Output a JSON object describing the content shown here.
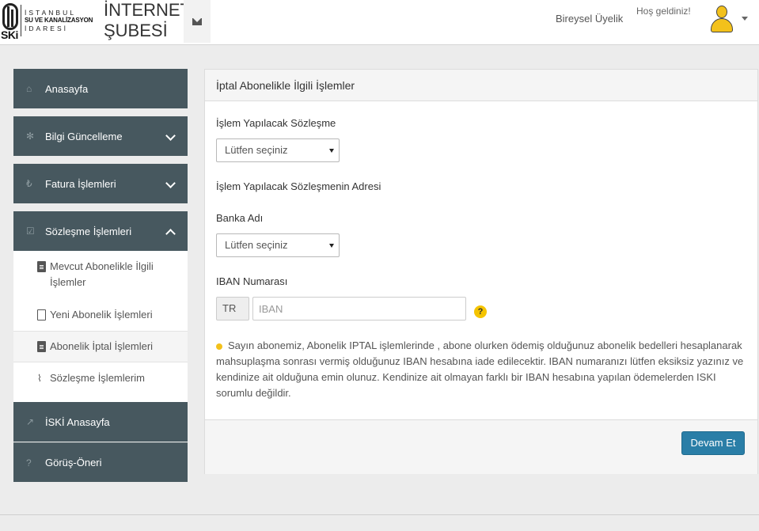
{
  "header": {
    "logo": {
      "mark": "SKi",
      "line1": "İSTANBUL",
      "line2": "SU VE KANALİZASYON",
      "line3": "İDARESİ"
    },
    "brand_line1": "İNTERNET",
    "brand_line2": "ŞUBESİ",
    "mail_icon": "envelope-icon",
    "membership": "Bireysel Üyelik",
    "welcome": "Hoş geldiniz!",
    "avatar_icon": "user-icon",
    "colors": {
      "avatar": "#f3c11b"
    }
  },
  "sidebar": {
    "colors": {
      "nav_bg": "#47585f",
      "nav_text": "#ffffff"
    },
    "items": [
      {
        "label": "Anasayfa",
        "icon": "home-icon"
      },
      {
        "label": "Bilgi Güncelleme",
        "icon": "gear-icon"
      },
      {
        "label": "Fatura İşlemleri",
        "icon": "lira-icon"
      },
      {
        "label": "Sözleşme İşlemleri",
        "icon": "check-square-icon"
      },
      {
        "label": "İSKİ Anasayfa",
        "icon": "external-link-icon"
      },
      {
        "label": "Görüş-Öneri",
        "icon": "question-circle-icon"
      }
    ],
    "subitems": [
      {
        "label": "Mevcut Abonelikle İlgili İşlemler",
        "icon": "file-icon"
      },
      {
        "label": "Yeni Abonelik İşlemleri",
        "icon": "file-outline-icon"
      },
      {
        "label": "Abonelik İptal İşlemleri",
        "icon": "file-text-icon"
      },
      {
        "label": "Sözleşme İşlemlerim",
        "icon": "paperclip-icon"
      }
    ]
  },
  "panel": {
    "title": "İptal Abonelikle İlgili İşlemler",
    "contract_label": "İşlem Yapılacak Sözleşme",
    "contract_select": "Lütfen seçiniz",
    "address_label": "İşlem Yapılacak Sözleşmenin Adresi",
    "bank_label": "Banka Adı",
    "bank_select": "Lütfen seçiniz",
    "iban_label": "IBAN Numarası",
    "iban_prefix": "TR",
    "iban_placeholder": "IBAN",
    "help_icon": "question-icon",
    "notice": "Sayın abonemiz, Abonelik IPTAL işlemlerinde , abone olurken ödemiş olduğunuz abonelik bedelleri hesaplanarak mahsuplaşma sonrası vermiş olduğunuz IBAN hesabına iade edilecektir. IBAN numaranızı lütfen eksiksiz yazınız ve kendinize ait olduğuna emin olunuz. Kendinize ait olmayan farklı bir IBAN hesabına yapılan ödemelerden ISKI sorumlu değildir.",
    "continue_button": "Devam Et",
    "colors": {
      "button": "#2a7ea7"
    }
  }
}
